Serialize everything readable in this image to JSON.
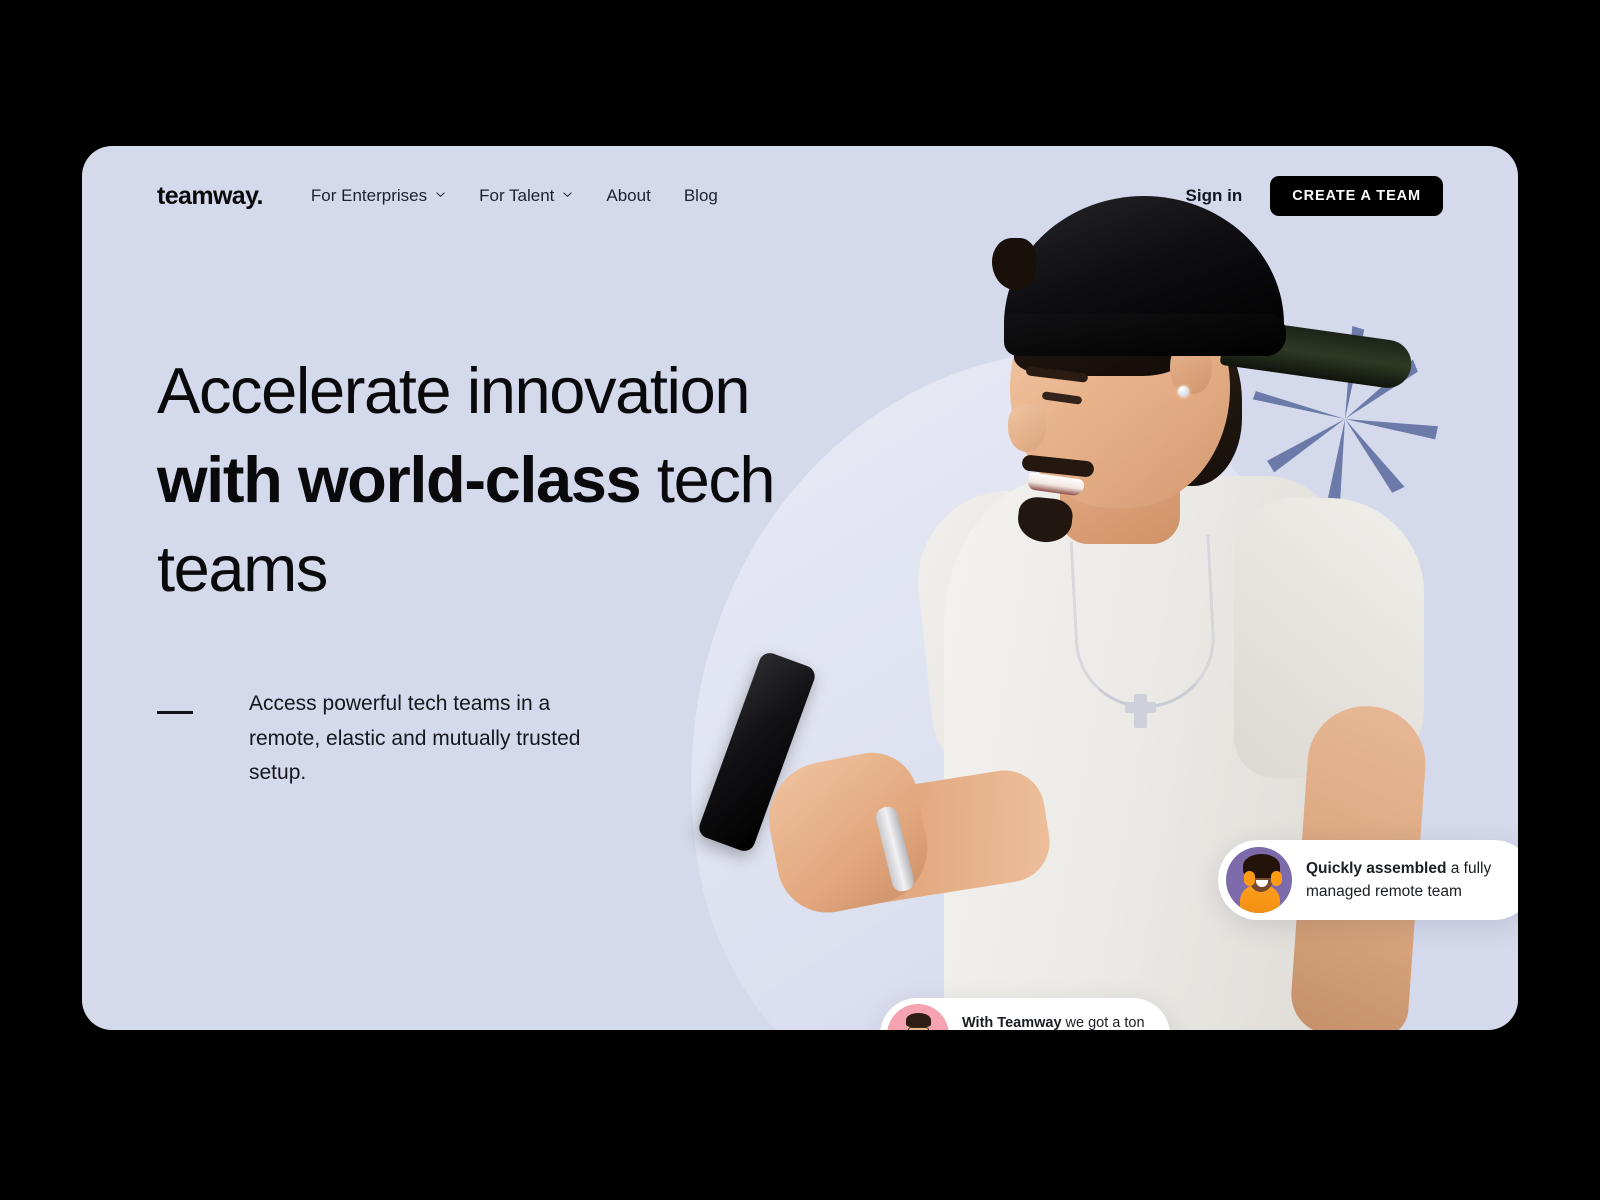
{
  "theme": {
    "page_background": "#000000",
    "hero_background": "#d5d9ec",
    "accent_dark": "#000000",
    "sparkle_color": "#6b7aa8",
    "avatar_1_bg": "#7c6aab",
    "avatar_2_bg": "#f5a2b1",
    "card_bg": "#ffffff"
  },
  "nav": {
    "logo": "teamway.",
    "links": [
      {
        "label": "For Enterprises",
        "has_dropdown": true,
        "icon": "chevron-down-icon"
      },
      {
        "label": "For Talent",
        "has_dropdown": true,
        "icon": "chevron-down-icon"
      },
      {
        "label": "About",
        "has_dropdown": false,
        "icon": ""
      },
      {
        "label": "Blog",
        "has_dropdown": false,
        "icon": ""
      }
    ],
    "signin_label": "Sign in",
    "cta_label": "CREATE A TEAM"
  },
  "hero": {
    "headline": {
      "part1": "Accelerate innovation ",
      "part2": "with world-class",
      "part3": " tech teams"
    },
    "subcopy": "Access powerful tech teams in a remote, elastic and mutually trusted setup."
  },
  "testimonials": [
    {
      "id": "quickly-assembled",
      "bold_text": "Quickly assembled",
      "rest_text": " a fully managed remote team",
      "avatar": "woman-orange-headphones-avatar"
    },
    {
      "id": "with-teamway",
      "bold_text": "With Teamway",
      "rest_text": " we got a ton of flexibility for a good price",
      "avatar": "man-glasses-denim-avatar"
    }
  ],
  "decorations": {
    "sparkle": "seven-point-sparkle-icon",
    "blob": "background-blob-shape",
    "person_photo": "man-backwards-cap-holding-phone"
  }
}
